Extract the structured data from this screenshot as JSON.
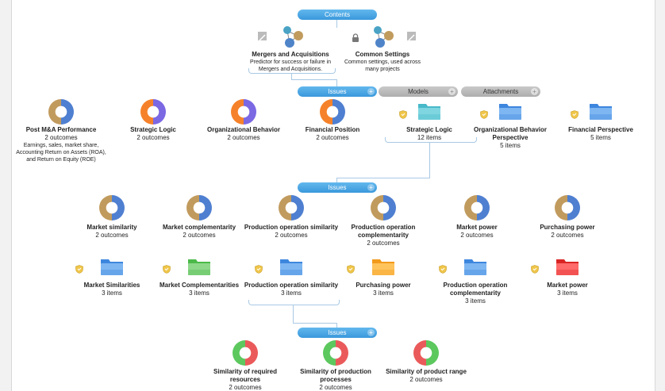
{
  "colors": {
    "pill_blue": "#3a98db",
    "pill_gray": "#b5b5b5",
    "connector": "#a9c9e4"
  },
  "contents": {
    "label": "Contents"
  },
  "top_models": [
    {
      "title": "Mergers and Acquisitions",
      "desc": "Predictor for success or failure in Mergers and Acquisitions."
    },
    {
      "title": "Common Settings",
      "desc": "Common settings, used across many projects"
    }
  ],
  "tabs": {
    "issues": "Issues",
    "models": "Models",
    "attachments": "Attachments"
  },
  "level1_issues": [
    {
      "title": "Post M&A Performance",
      "sub": "2 outcomes",
      "desc": "Earnings, sales, market share, Accounting Return on Assets (ROA), and Return on Equity (ROE)",
      "chart": "tan-blue"
    },
    {
      "title": "Strategic Logic",
      "sub": "2 outcomes",
      "chart": "orange-purple"
    },
    {
      "title": "Organizational Behavior",
      "sub": "2 outcomes",
      "chart": "orange-purple"
    },
    {
      "title": "Financial Position",
      "sub": "2 outcomes",
      "chart": "orange-blue"
    }
  ],
  "level1_models": [
    {
      "title": "Strategic Logic",
      "sub": "12 items",
      "folder": "teal"
    },
    {
      "title": "Organizational Behavior Perspective",
      "sub": "5 items",
      "folder": "blue"
    },
    {
      "title": "Financial Perspective",
      "sub": "5 items",
      "folder": "blue"
    }
  ],
  "level2_issues_label": "Issues",
  "level2_issues": [
    {
      "title": "Market similarity",
      "sub": "2 outcomes"
    },
    {
      "title": "Market complementarity",
      "sub": "2 outcomes"
    },
    {
      "title": "Production operation similarity",
      "sub": "2 outcomes"
    },
    {
      "title": "Production operation complementarity",
      "sub": "2 outcomes"
    },
    {
      "title": "Market power",
      "sub": "2 outcomes"
    },
    {
      "title": "Purchasing power",
      "sub": "2 outcomes"
    }
  ],
  "level2_models": [
    {
      "title": "Market Similarities",
      "sub": "3 items",
      "folder": "blue"
    },
    {
      "title": "Market Complementarities",
      "sub": "3 items",
      "folder": "green"
    },
    {
      "title": "Production operation similarity",
      "sub": "3 items",
      "folder": "blue"
    },
    {
      "title": "Purchasing power",
      "sub": "3 items",
      "folder": "orange"
    },
    {
      "title": "Production operation complementarity",
      "sub": "3 items",
      "folder": "blue"
    },
    {
      "title": "Market power",
      "sub": "3 items",
      "folder": "red"
    }
  ],
  "level3_issues_label": "Issues",
  "level3_issues": [
    {
      "title": "Similarity of required resources",
      "sub": "2 outcomes"
    },
    {
      "title": "Similarity of production processes",
      "sub": "2 outcomes"
    },
    {
      "title": "Similarity of product range",
      "sub": "2 outcomes"
    }
  ]
}
